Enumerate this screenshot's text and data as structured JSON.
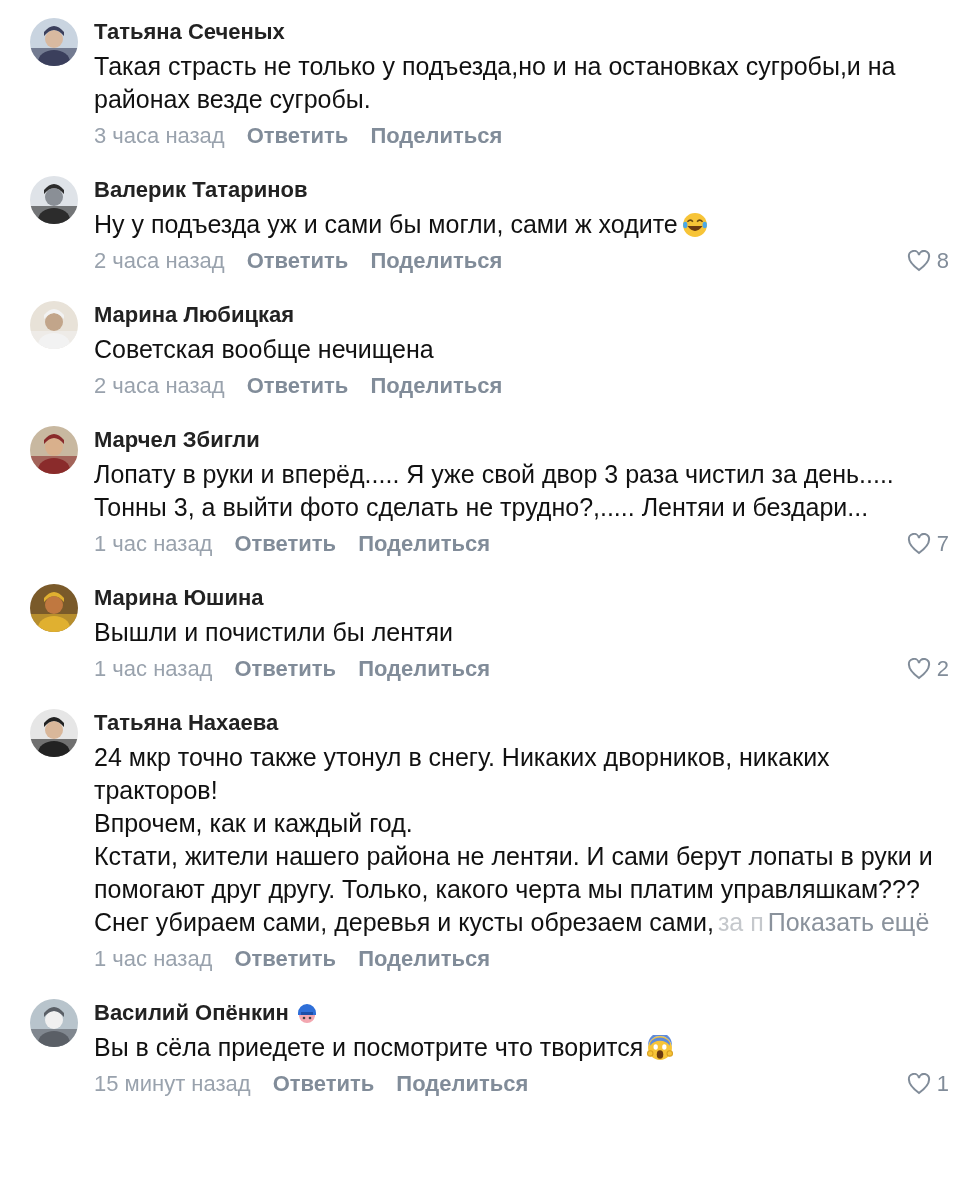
{
  "comments": [
    {
      "author": "Татьяна Сеченых",
      "lines": [
        "Такая страсть не только у подъезда,но и на остановках сугробы,и на",
        "районах везде сугробы."
      ],
      "time": "3 часа назад",
      "reply": "Ответить",
      "share": "Поделиться"
    },
    {
      "author": "Валерик Татаринов",
      "lines": [
        "Ну у подъезда уж и сами бы могли, сами ж ходите"
      ],
      "emoji": {
        "kind": "laughing"
      },
      "time": "2 часа назад",
      "reply": "Ответить",
      "share": "Поделиться",
      "likes": "8"
    },
    {
      "author": "Марина Любицкая",
      "lines": [
        "Советская вообще нечищена"
      ],
      "time": "2 часа назад",
      "reply": "Ответить",
      "share": "Поделиться"
    },
    {
      "author": "Марчел Збигли",
      "lines": [
        "Лопату в руки и вперёд..... Я уже свой двор 3 раза чистил за день.....",
        "Тонны 3, а выйти фото сделать не трудно?,..... Лентяи и бездари..."
      ],
      "time": "1 час назад",
      "reply": "Ответить",
      "share": "Поделиться",
      "likes": "7"
    },
    {
      "author": "Марина Юшина",
      "lines": [
        "Вышли и почистили бы лентяи"
      ],
      "time": "1 час назад",
      "reply": "Ответить",
      "share": "Поделиться",
      "likes": "2"
    },
    {
      "author": "Татьяна Нахаева",
      "lines": [
        "24 мкр точно также утонул в снегу. Никаких дворников, никаких",
        "тракторов!",
        "Впрочем, как и каждый год.",
        "Кстати, жители нашего района не лентяи. И сами берут лопаты в руки и",
        "помогают друг другу. Только, какого черта мы платим управляшкам???",
        "Снег убираем сами, деревья и кусты обрезаем сами,"
      ],
      "faded_tail": "за п",
      "more_link": "Показать ещё",
      "time": "1 час назад",
      "reply": "Ответить",
      "share": "Поделиться"
    },
    {
      "author": "Василий Опёнкин",
      "name_badge": true,
      "lines": [
        "Вы в сёла приедете и посмотрите что творится"
      ],
      "emoji": {
        "kind": "scream"
      },
      "time": "15 минут назад",
      "reply": "Ответить",
      "share": "Поделиться",
      "likes": "1"
    }
  ]
}
